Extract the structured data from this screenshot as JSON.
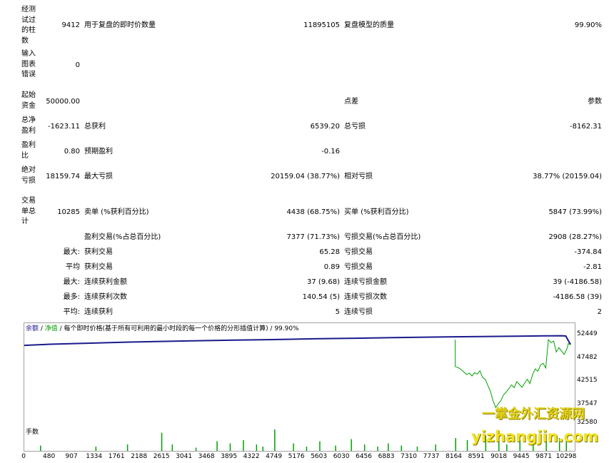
{
  "report": {
    "bars_tested_label": "经测试过的柱数",
    "bars_tested_value": "9412",
    "ticks_label": "用于复盘的即时价数量",
    "ticks_value": "11895105",
    "quality_label": "复盘模型的质量",
    "quality_value": "99.90%",
    "mismatch_label": "输入图表错误",
    "mismatch_value": "0",
    "deposit_label": "起始资金",
    "deposit_value": "50000.00",
    "spread_label": "点差",
    "spread_value": "参数",
    "net_profit_label": "总净盈利",
    "net_profit_value": "-1623.11",
    "gross_profit_label": "总获利",
    "gross_profit_value": "6539.20",
    "gross_loss_label": "总亏损",
    "gross_loss_value": "-8162.31",
    "profit_factor_label": "盈利比",
    "profit_factor_value": "0.80",
    "expected_payoff_label": "预期盈利",
    "expected_payoff_value": "-0.16",
    "abs_dd_label": "绝对亏损",
    "abs_dd_value": "18159.74",
    "max_dd_label": "最大亏损",
    "max_dd_value": "20159.04 (38.77%)",
    "rel_dd_label": "相对亏损",
    "rel_dd_value": "38.77% (20159.04)",
    "total_trades_label": "交易单总计",
    "total_trades_value": "10285",
    "short_label": "卖单 (%获利百分比)",
    "short_value": "4438 (68.75%)",
    "long_label": "买单 (%获利百分比)",
    "long_value": "5847 (73.99%)",
    "profit_trades_label": "盈利交易(%占总百分比)",
    "profit_trades_value": "7377 (71.73%)",
    "loss_trades_label": "亏损交易(%占总百分比)",
    "loss_trades_value": "2908 (28.27%)",
    "largest_prefix": "最大:",
    "largest_profit_label": "获利交易",
    "largest_profit_value": "65.28",
    "largest_loss_label": "亏损交易",
    "largest_loss_value": "-374.84",
    "average_prefix": "平均",
    "average_profit_label": "获利交易",
    "average_profit_value": "0.89",
    "average_loss_label": "亏损交易",
    "average_loss_value": "-2.81",
    "maximum_prefix": "最大:",
    "max_consec_wins_label": "连续获利金额",
    "max_consec_wins_value": "37 (9.68)",
    "max_consec_losses_label": "连续亏损金额",
    "max_consec_losses_value": "39 (-4186.58)",
    "maximal_prefix": "最多:",
    "max_consec_profit_label": "连续获利次数",
    "max_consec_profit_value": "140.54 (5)",
    "max_consec_loss_label": "连续亏损次数",
    "max_consec_loss_value": "-4186.58 (39)",
    "avg_prefix": "平均:",
    "avg_consec_wins_label": "连续获利",
    "avg_consec_wins_value": "5",
    "avg_consec_losses_label": "连续亏损",
    "avg_consec_losses_value": "2"
  },
  "chart_legend": {
    "balance": "余额",
    "sep1": " / ",
    "equity": "净值",
    "rest": " / 每个即时价格(基于所有可利用的最小时段的每一个价格的分形插值计算) / 99.90%"
  },
  "volume_label": "手数",
  "watermark": {
    "line1": "一掌金外汇资源网",
    "line2": "yizhangjin.com"
  },
  "colors": {
    "balance": "#1a1a8c",
    "equity": "#00a000",
    "volume": "#00a000",
    "legend_balance": "#1a1a8c",
    "legend_equity": "#00a000"
  },
  "chart_data": {
    "type": "line",
    "y_ticks": [
      "52449",
      "47482",
      "42515",
      "37547",
      "32580"
    ],
    "ylim": [
      32580,
      52449
    ],
    "x_ticks": [
      "0",
      "480",
      "907",
      "1334",
      "1761",
      "2188",
      "2615",
      "3041",
      "3468",
      "3895",
      "4322",
      "4749",
      "5176",
      "5603",
      "6030",
      "6456",
      "6883",
      "7310",
      "7737",
      "8164",
      "8591",
      "9018",
      "9445",
      "9871",
      "10298"
    ],
    "xlim": [
      0,
      10450
    ],
    "series": [
      {
        "key": "balance",
        "x": [
          0,
          500,
          1000,
          1500,
          2000,
          2500,
          3000,
          3500,
          4000,
          4500,
          5000,
          5500,
          6000,
          6500,
          7000,
          7500,
          8000,
          8500,
          9000,
          9500,
          10000,
          10200,
          10280,
          10330,
          10370
        ],
        "y": [
          50000,
          50250,
          50400,
          50560,
          50700,
          50830,
          50930,
          51020,
          51110,
          51200,
          51300,
          51400,
          51480,
          51560,
          51640,
          51720,
          51800,
          51860,
          51920,
          51980,
          52040,
          52060,
          52000,
          51000,
          50200
        ]
      },
      {
        "key": "equity",
        "x": [
          8180,
          8182,
          8250,
          8300,
          8350,
          8400,
          8450,
          8500,
          8550,
          8600,
          8650,
          8700,
          8750,
          8800,
          8850,
          8900,
          8950,
          9000,
          9050,
          9100,
          9150,
          9200,
          9250,
          9300,
          9350,
          9400,
          9450,
          9500,
          9550,
          9600,
          9650,
          9700,
          9750,
          9800,
          9850,
          9900,
          9950,
          10000,
          10050,
          10100,
          10150,
          10200,
          10250,
          10300,
          10330,
          10370
        ],
        "y": [
          51200,
          45500,
          45200,
          44800,
          44300,
          43800,
          44100,
          43500,
          44200,
          43900,
          44600,
          43200,
          42800,
          41500,
          40200,
          38200,
          36800,
          37600,
          38300,
          39500,
          40100,
          40800,
          41600,
          41000,
          42300,
          41700,
          41100,
          42000,
          42800,
          41900,
          43800,
          45000,
          44500,
          45800,
          46200,
          45200,
          51200,
          50600,
          50900,
          48600,
          49500,
          48800,
          48100,
          49200,
          50400,
          50100
        ]
      }
    ],
    "volume": {
      "x": [
        300,
        1350,
        1950,
        2600,
        2800,
        3250,
        3650,
        3900,
        4150,
        4400,
        4520,
        4745,
        5100,
        5350,
        5600,
        5900,
        6200,
        6450,
        6700,
        6900,
        7150,
        7450,
        7800,
        8180,
        8400,
        8750,
        9000,
        9150,
        9400,
        9650,
        9900,
        10150,
        10280
      ],
      "y": [
        0.25,
        0.2,
        0.3,
        0.85,
        0.3,
        0.15,
        0.45,
        0.35,
        0.5,
        0.3,
        0.2,
        1.0,
        0.35,
        0.2,
        0.45,
        0.25,
        0.55,
        0.3,
        0.2,
        0.35,
        0.25,
        0.2,
        0.3,
        0.6,
        0.5,
        0.7,
        0.4,
        0.3,
        0.5,
        0.4,
        0.5,
        0.6,
        0.45
      ]
    }
  }
}
